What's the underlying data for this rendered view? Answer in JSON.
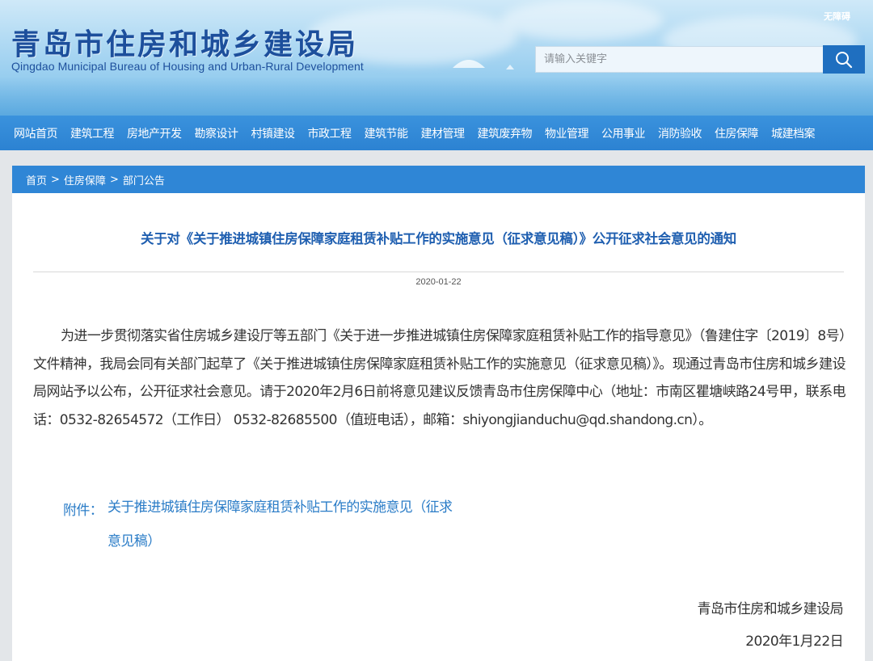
{
  "header": {
    "title": "青岛市住房和城乡建设局",
    "subtitle": "Qingdao Municipal Bureau of Housing and Urban-Rural Development",
    "accessibility_link": "无障碍",
    "search": {
      "placeholder": "请输入关键字",
      "icon": "search-icon"
    }
  },
  "nav": {
    "items": [
      {
        "label": "网站首页"
      },
      {
        "label": "建筑工程"
      },
      {
        "label": "房地产开发"
      },
      {
        "label": "勘察设计"
      },
      {
        "label": "村镇建设"
      },
      {
        "label": "市政工程"
      },
      {
        "label": "建筑节能"
      },
      {
        "label": "建材管理"
      },
      {
        "label": "建筑废弃物"
      },
      {
        "label": "物业管理"
      },
      {
        "label": "公用事业"
      },
      {
        "label": "消防验收"
      },
      {
        "label": "住房保障"
      },
      {
        "label": "城建档案"
      }
    ]
  },
  "breadcrumb": {
    "items": [
      "首页",
      "住房保障",
      "部门公告"
    ],
    "separator": ">"
  },
  "article": {
    "title": "关于对《关于推进城镇住房保障家庭租赁补贴工作的实施意见（征求意见稿）》公开征求社会意见的通知",
    "date": "2020-01-22",
    "body": "为进一步贯彻落实省住房城乡建设厅等五部门《关于进一步推进城镇住房保障家庭租赁补贴工作的指导意见》（鲁建住字〔2019〕8号）文件精神，我局会同有关部门起草了《关于推进城镇住房保障家庭租赁补贴工作的实施意见（征求意见稿）》。现通过青岛市住房和城乡建设局网站予以公布，公开征求社会意见。请于2020年2月6日前将意见建议反馈青岛市住房保障中心（地址：市南区瞿塘峡路24号甲，联系电话：0532-82654572（工作日） 0532-82685500（值班电话），邮箱：shiyongjianduchu@qd.shandong.cn）。",
    "attachment_label": "附件：",
    "attachment_link": "关于推进城镇住房保障家庭租赁补贴工作的实施意见（征求意见稿）",
    "signature_org": "青岛市住房和城乡建设局",
    "signature_date": "2020年1月22日"
  },
  "colors": {
    "brand_blue": "#1d4f9c",
    "nav_blue": "#2c82d2",
    "title_blue": "#1f5fb0",
    "link_blue": "#2a7cc7"
  }
}
